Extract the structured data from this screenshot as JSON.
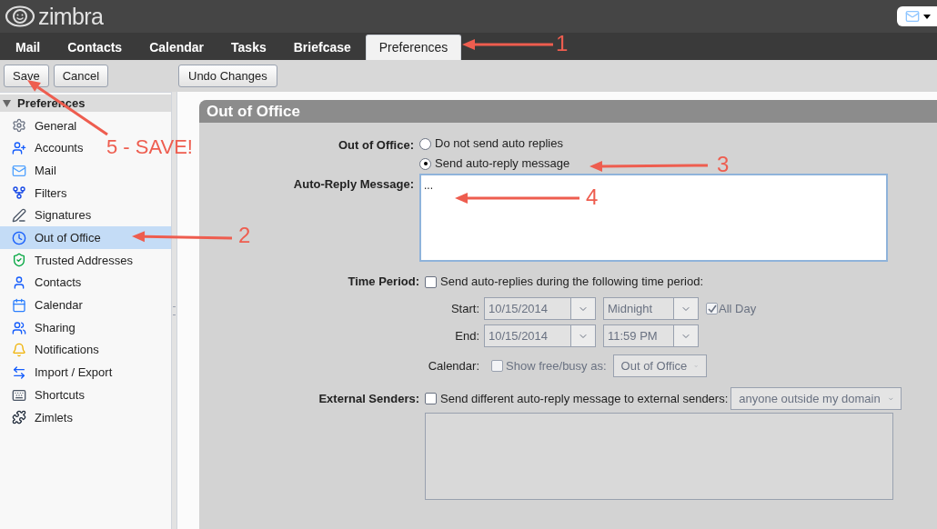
{
  "app": {
    "logo": "zimbra"
  },
  "tabs": [
    {
      "label": "Mail",
      "selected": false
    },
    {
      "label": "Contacts",
      "selected": false
    },
    {
      "label": "Calendar",
      "selected": false
    },
    {
      "label": "Tasks",
      "selected": false
    },
    {
      "label": "Briefcase",
      "selected": false
    },
    {
      "label": "Preferences",
      "selected": true
    }
  ],
  "toolbar": {
    "left": [
      "Save",
      "Cancel"
    ],
    "right": [
      "Undo Changes"
    ]
  },
  "sidebar": {
    "title": "Preferences",
    "expanded": true,
    "items": [
      {
        "label": "General",
        "selected": false
      },
      {
        "label": "Accounts",
        "selected": false
      },
      {
        "label": "Mail",
        "selected": false
      },
      {
        "label": "Filters",
        "selected": false
      },
      {
        "label": "Signatures",
        "selected": false
      },
      {
        "label": "Out of Office",
        "selected": true
      },
      {
        "label": "Trusted Addresses",
        "selected": false
      },
      {
        "label": "Contacts",
        "selected": false
      },
      {
        "label": "Calendar",
        "selected": false
      },
      {
        "label": "Sharing",
        "selected": false
      },
      {
        "label": "Notifications",
        "selected": false
      },
      {
        "label": "Import / Export",
        "selected": false
      },
      {
        "label": "Shortcuts",
        "selected": false
      },
      {
        "label": "Zimlets",
        "selected": false
      }
    ]
  },
  "panel": {
    "title": "Out of Office",
    "out_of_office": {
      "label": "Out of Office:",
      "options": [
        {
          "label": "Do not send auto replies",
          "selected": false
        },
        {
          "label": "Send auto-reply message",
          "selected": true
        }
      ]
    },
    "message": {
      "label": "Auto-Reply Message:",
      "value": "..."
    },
    "time_period": {
      "label": "Time Period:",
      "checkbox": {
        "label": "Send auto-replies during the following time period:",
        "checked": false
      },
      "start": {
        "label": "Start:",
        "date": "10/15/2014",
        "time": "Midnight",
        "disabled": true
      },
      "end": {
        "label": "End:",
        "date": "10/15/2014",
        "time": "11:59 PM",
        "disabled": true
      },
      "all_day": {
        "label": "All Day",
        "checked": true,
        "disabled": true
      }
    },
    "calendar": {
      "label": "Calendar:",
      "checkbox": {
        "label": "Show free/busy as:",
        "checked": false,
        "disabled": true
      },
      "select": "Out of Office"
    },
    "external": {
      "label": "External Senders:",
      "checkbox": {
        "label": "Send different auto-reply message to external senders:",
        "checked": false
      },
      "select": "anyone outside my domain",
      "message_disabled": true
    }
  },
  "annotations": [
    {
      "label": "1"
    },
    {
      "label": "2"
    },
    {
      "label": "3"
    },
    {
      "label": "4"
    },
    {
      "label": "5 - SAVE!"
    }
  ]
}
